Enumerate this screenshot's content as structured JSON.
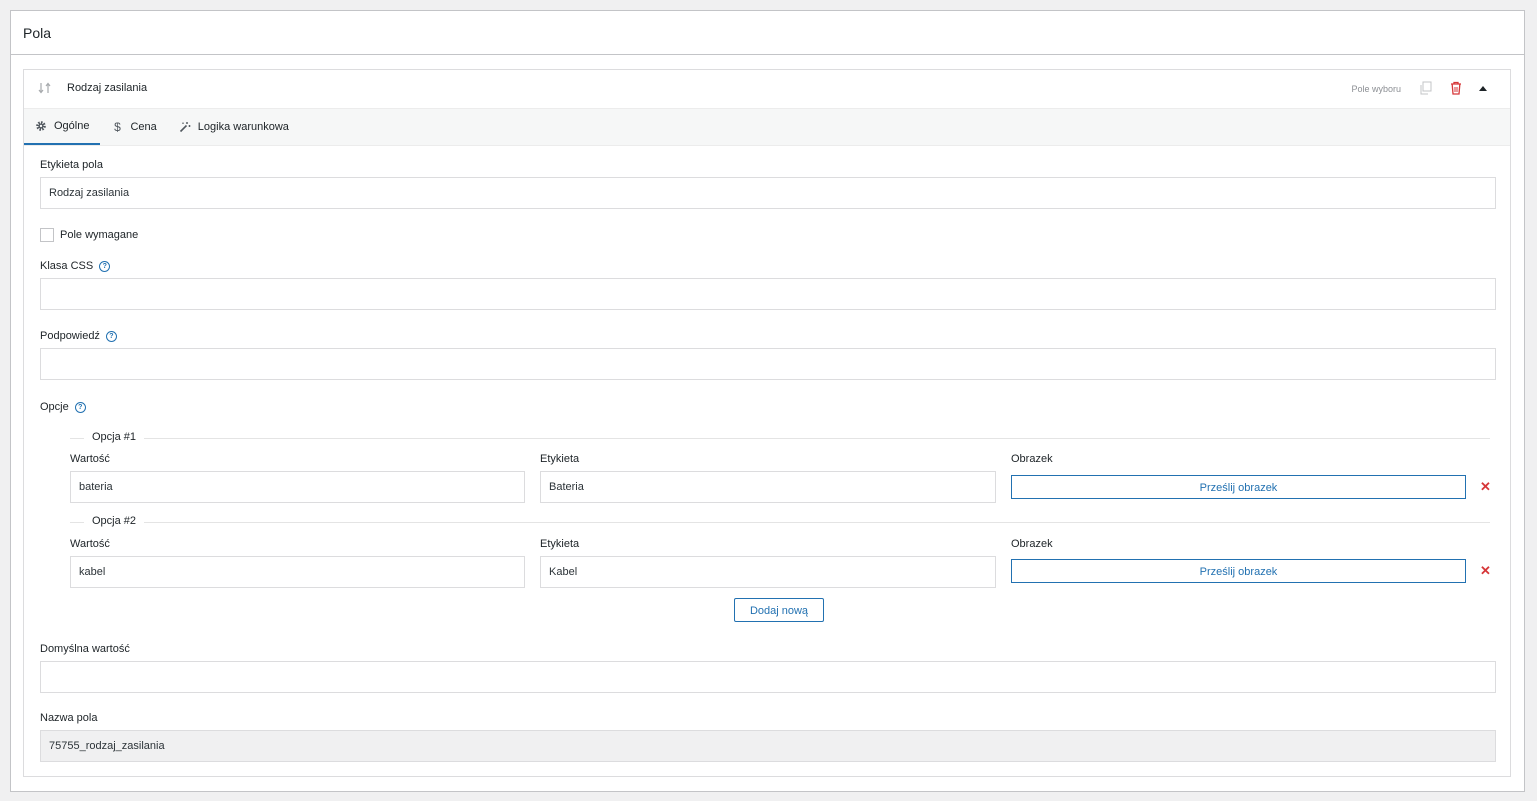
{
  "panel": {
    "title": "Pola"
  },
  "field": {
    "name": "Rodzaj zasilania",
    "type_label": "Pole wyboru",
    "icons": {
      "drag": "sort-arrows-icon",
      "copy": "copy-icon",
      "delete": "trash-icon",
      "collapse": "caret-up-icon"
    },
    "colors": {
      "accent": "#2271b1",
      "danger": "#d63638"
    }
  },
  "tabs": [
    {
      "label": "Ogólne",
      "icon": "gear-icon",
      "active": true
    },
    {
      "label": "Cena",
      "icon": "dollar-icon",
      "active": false
    },
    {
      "label": "Logika warunkowa",
      "icon": "wand-icon",
      "active": false
    }
  ],
  "form": {
    "label_field_label": "Etykieta pola",
    "label_field_value": "Rodzaj zasilania",
    "required_label": "Pole wymagane",
    "required_checked": false,
    "css_class_label": "Klasa CSS",
    "css_class_value": "",
    "hint_label": "Podpowiedź",
    "hint_value": "",
    "options_label": "Opcje",
    "help_glyph": "?",
    "options": [
      {
        "legend": "Opcja #1",
        "value_label": "Wartość",
        "value": "bateria",
        "label_label": "Etykieta",
        "label": "Bateria",
        "image_label": "Obrazek",
        "upload_button": "Prześlij obrazek",
        "remove_glyph": "✕"
      },
      {
        "legend": "Opcja #2",
        "value_label": "Wartość",
        "value": "kabel",
        "label_label": "Etykieta",
        "label": "Kabel",
        "image_label": "Obrazek",
        "upload_button": "Prześlij obrazek",
        "remove_glyph": "✕"
      }
    ],
    "add_new_button": "Dodaj nową",
    "default_value_label": "Domyślna wartość",
    "default_value": "",
    "field_name_label": "Nazwa pola",
    "field_name_value": "75755_rodzaj_zasilania"
  }
}
